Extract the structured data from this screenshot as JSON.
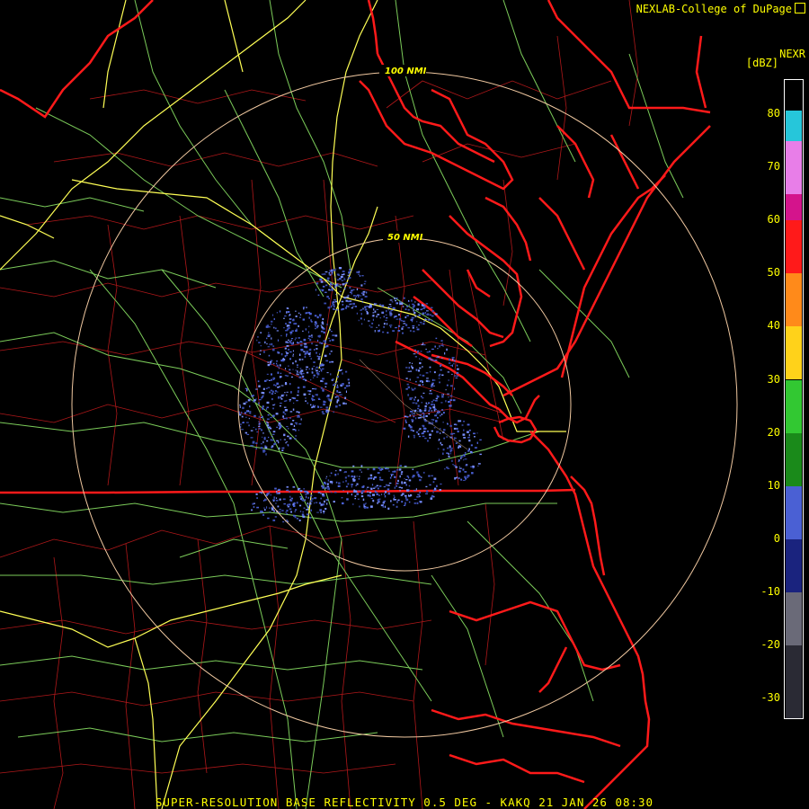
{
  "header": {
    "credit": "NEXLAB-College of DuPage",
    "product_code": "NEXR",
    "units": "[dBZ]"
  },
  "footer": {
    "caption": "SUPER-RESOLUTION BASE REFLECTIVITY 0.5 DEG - KAKQ 21 JAN 26 08:30"
  },
  "range_rings": [
    {
      "label": "100 NMI",
      "range_nmi": 100
    },
    {
      "label": "50 NMI",
      "range_nmi": 50
    }
  ],
  "color_scale": {
    "ticks": [
      "80",
      "70",
      "60",
      "50",
      "40",
      "30",
      "20",
      "10",
      "0",
      "-10",
      "-20",
      "-30"
    ],
    "bands": [
      {
        "from_dbz": 75,
        "to_dbz": 80,
        "color": "#26c6da"
      },
      {
        "from_dbz": 65,
        "to_dbz": 75,
        "color": "#e87ee8"
      },
      {
        "from_dbz": 60,
        "to_dbz": 65,
        "color": "#d4148c"
      },
      {
        "from_dbz": 50,
        "to_dbz": 60,
        "color": "#ff1a1a"
      },
      {
        "from_dbz": 40,
        "to_dbz": 50,
        "color": "#ff8a1a"
      },
      {
        "from_dbz": 30,
        "to_dbz": 40,
        "color": "#ffd21a"
      },
      {
        "from_dbz": 20,
        "to_dbz": 30,
        "color": "#32c832"
      },
      {
        "from_dbz": 10,
        "to_dbz": 20,
        "color": "#1a8a1a"
      },
      {
        "from_dbz": 0,
        "to_dbz": 10,
        "color": "#4a60d4"
      },
      {
        "from_dbz": -10,
        "to_dbz": 0,
        "color": "#1a237e"
      },
      {
        "from_dbz": -20,
        "to_dbz": -10,
        "color": "#6a6a78"
      },
      {
        "from_dbz": -35,
        "to_dbz": -20,
        "color": "#2a2a34"
      }
    ]
  },
  "colors": {
    "state_border": "#ff1a1a",
    "county_line": "#cc1a1a",
    "highway": "#ffff55",
    "road": "#88dd66",
    "range_ring": "#f0c8a0",
    "echo": "#4a60d4",
    "echo_light": "#7a90ff",
    "label": "#ffff00"
  }
}
